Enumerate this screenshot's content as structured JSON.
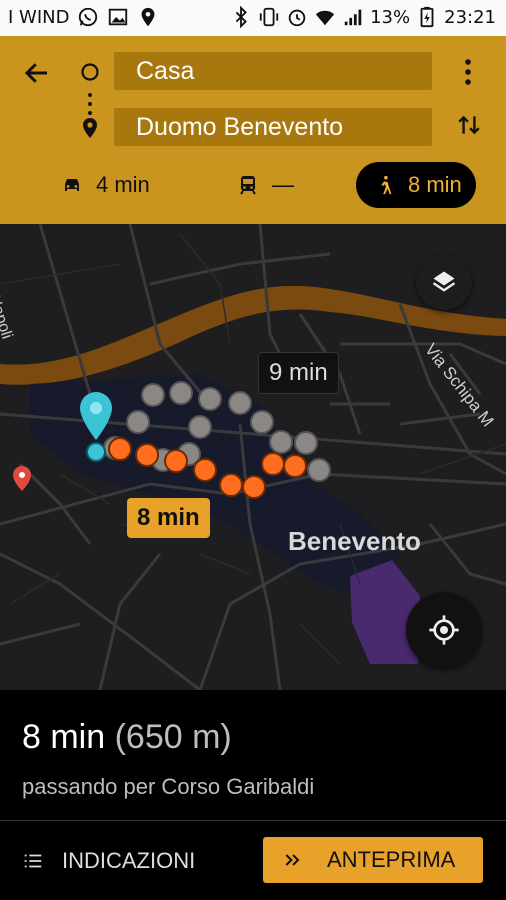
{
  "status_bar": {
    "carrier": "I WIND",
    "battery": "13%",
    "time": "23:21"
  },
  "header": {
    "origin": "Casa",
    "destination": "Duomo Benevento",
    "modes": [
      {
        "icon": "car-icon",
        "label": "4 min"
      },
      {
        "icon": "transit-icon",
        "label": "—"
      },
      {
        "icon": "walk-icon",
        "label": "8 min",
        "selected": true
      }
    ]
  },
  "map": {
    "street_labels": [
      "Via Schipa M",
      "e di Napoli"
    ],
    "place_label": "Benevento",
    "route_badges": {
      "alternative": "9 min",
      "selected": "8 min"
    }
  },
  "summary": {
    "time": "8 min",
    "distance": "(650 m)",
    "via": "passando per Corso Garibaldi"
  },
  "actions": {
    "directions_label": "INDICAZIONI",
    "preview_label": "ANTEPRIMA"
  },
  "colors": {
    "accent": "#c9951e",
    "route_selected": "#ff6d1f",
    "route_alt": "#8a8784",
    "pin": "#3cc3d6",
    "river": "#7a4a10"
  }
}
